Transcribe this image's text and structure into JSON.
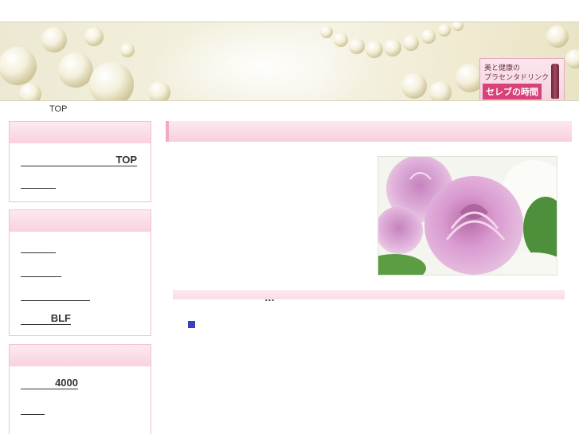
{
  "breadcrumb": {
    "label": "TOP"
  },
  "banner": {
    "logo_line1": "美と健康の",
    "logo_line2": "プラセンタドリンク",
    "logo_line3": "セレブの時間"
  },
  "sidebar": {
    "box1": {
      "links": [
        {
          "label": "TOP"
        },
        {
          "label": ""
        }
      ]
    },
    "box2": {
      "links": [
        {
          "label": ""
        },
        {
          "label": ""
        },
        {
          "label": ""
        },
        {
          "label": "BLF"
        }
      ]
    },
    "box3": {
      "links": [
        {
          "label": "4000"
        },
        {
          "label": ""
        }
      ]
    }
  },
  "main": {
    "heading": "",
    "subheading_ellipsis": "…"
  },
  "colors": {
    "accent_pink": "#f4a9c0",
    "header_pink": "#f8d0dd",
    "bullet_blue": "#3d3dbf"
  }
}
